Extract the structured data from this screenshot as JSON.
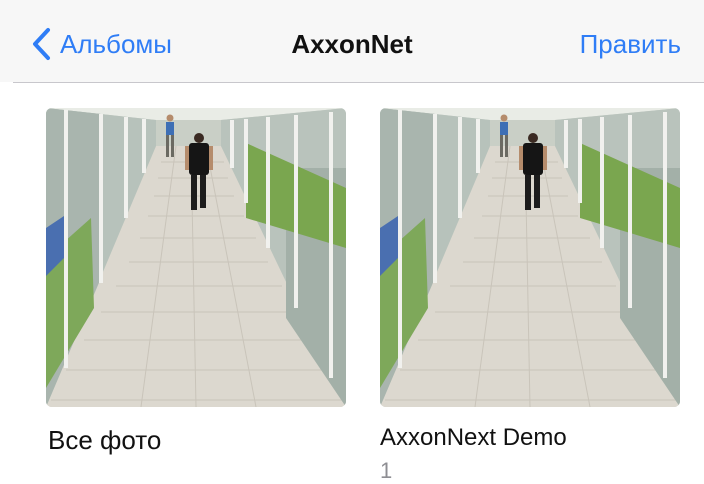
{
  "navbar": {
    "back_label": "Альбомы",
    "title": "AxxonNet",
    "edit_label": "Править",
    "accent_color": "#2f7df6"
  },
  "albums": [
    {
      "title": "Все фото",
      "thumbnail": "corridor-camera-frame"
    },
    {
      "title": "AxxonNext Demo",
      "count": "1",
      "thumbnail": "corridor-camera-frame"
    }
  ]
}
